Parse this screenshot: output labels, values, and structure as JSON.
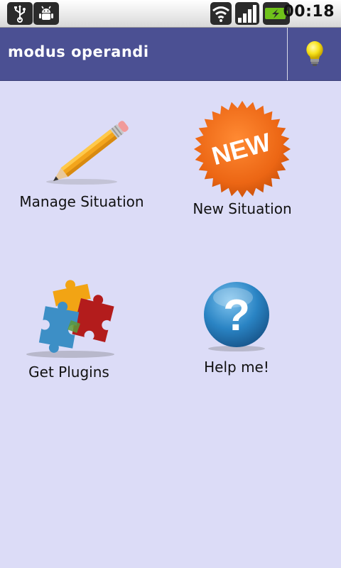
{
  "status_bar": {
    "time": "00:18",
    "icons": [
      "usb-icon",
      "debug-icon",
      "wifi-icon",
      "signal-icon",
      "battery-charging-icon"
    ],
    "battery_color": "#6fc21a"
  },
  "header": {
    "title": "modus operandi",
    "background": "#4b5093",
    "action_icon": "lightbulb-icon"
  },
  "menu": {
    "items": [
      {
        "label": "Manage Situation",
        "icon": "pencil-icon"
      },
      {
        "label": "New Situation",
        "icon": "new-badge-icon",
        "badge_text": "NEW"
      },
      {
        "label": "Get Plugins",
        "icon": "puzzle-icon"
      },
      {
        "label": "Help me!",
        "icon": "question-icon"
      }
    ]
  }
}
